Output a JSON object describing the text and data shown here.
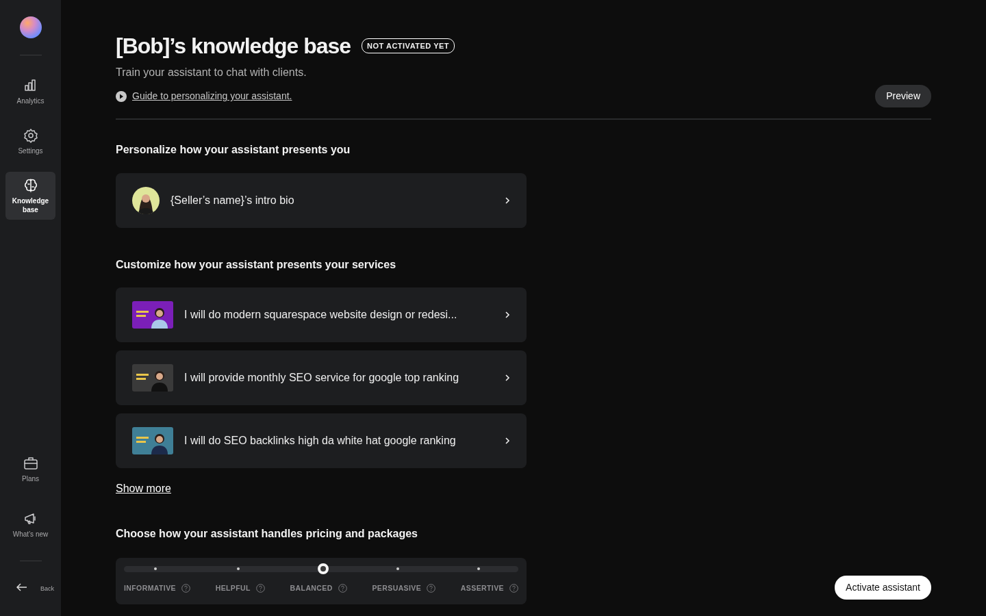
{
  "sidebar": {
    "items": [
      {
        "kind": "analytics",
        "label": "Analytics",
        "selected": false
      },
      {
        "kind": "settings",
        "label": "Settings",
        "selected": false
      },
      {
        "kind": "brain",
        "label": "Knowledge base",
        "selected": true
      }
    ],
    "bottom_items": [
      {
        "kind": "plans",
        "label": "Plans",
        "selected": false
      },
      {
        "kind": "news",
        "label": "What’s new",
        "selected": false
      }
    ],
    "back": "Back"
  },
  "header": {
    "title": "[Bob]’s knowledge base",
    "badge": "NOT ACTIVATED YET",
    "subtitle": "Train your assistant to chat with clients.",
    "guide_link": "Guide to personalizing your assistant.",
    "preview_button": "Preview"
  },
  "intro_section": {
    "heading": "Personalize how your assistant presents you",
    "items": [
      {
        "label": "{Seller’s name}’s intro bio"
      }
    ]
  },
  "services_section": {
    "heading": "Customize how your assistant presents your services",
    "items": [
      {
        "label": "I will do modern squarespace website design or redesi...",
        "kind": "picture"
      },
      {
        "label": "I will provide monthly SEO service for google top ranking",
        "kind": "picture"
      },
      {
        "label": "I will do SEO backlinks high da white hat google ranking",
        "kind": "picture"
      }
    ],
    "show_more": "Show more"
  },
  "pricing_section": {
    "heading": "Choose how your assistant handles pricing and packages",
    "options": [
      {
        "label": "INFORMATIVE",
        "selected": false
      },
      {
        "label": "HELPFUL",
        "selected": false
      },
      {
        "label": "BALANCED",
        "selected": true
      },
      {
        "label": "PERSUASIVE",
        "selected": false
      },
      {
        "label": "ASSERTIVE",
        "selected": false
      }
    ]
  },
  "activate_button": "Activate assistant"
}
